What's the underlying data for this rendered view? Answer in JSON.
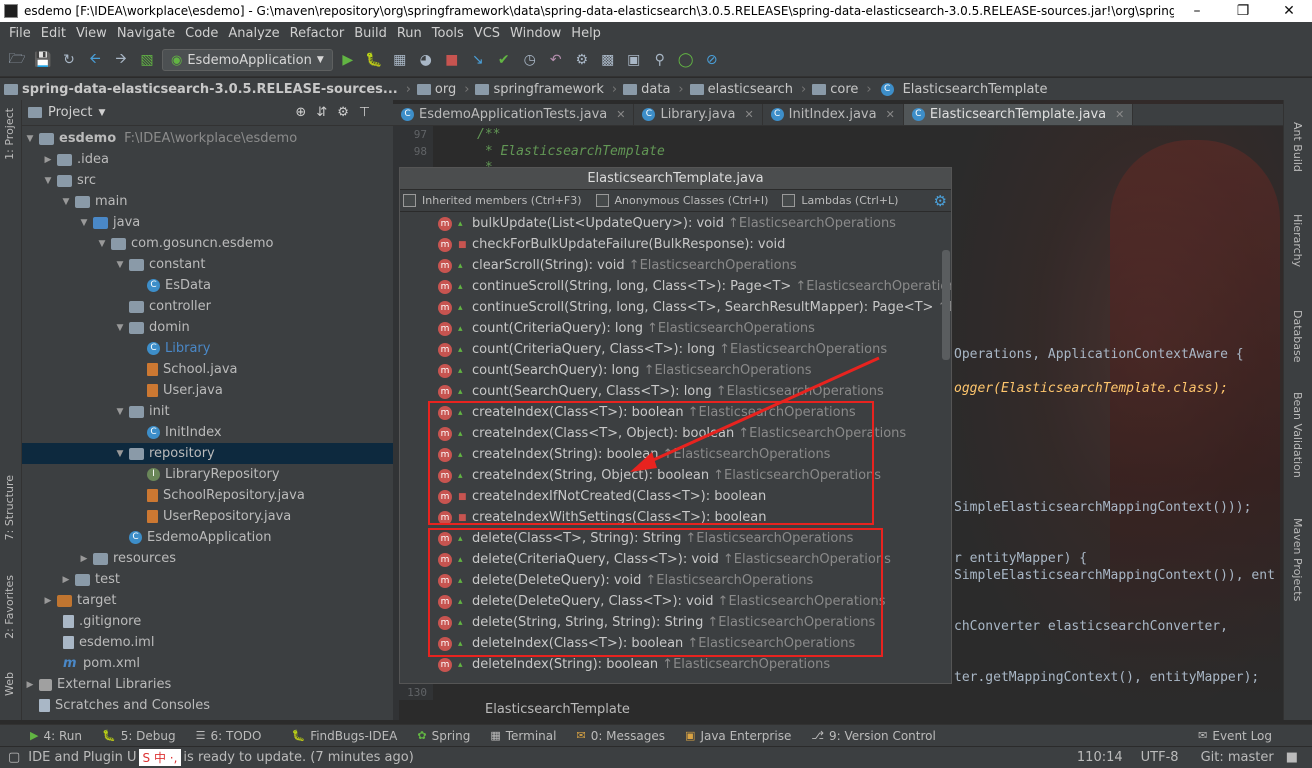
{
  "window": {
    "title": "esdemo [F:\\IDEA\\workplace\\esdemo] - G:\\maven\\repository\\org\\springframework\\data\\spring-data-elasticsearch\\3.0.5.RELEASE\\spring-data-elasticsearch-3.0.5.RELEASE-sources.jar!\\org\\springf..."
  },
  "menu": [
    "File",
    "Edit",
    "View",
    "Navigate",
    "Code",
    "Analyze",
    "Refactor",
    "Build",
    "Run",
    "Tools",
    "VCS",
    "Window",
    "Help"
  ],
  "toolbar": {
    "run_config": "EsdemoApplication"
  },
  "breadcrumb": [
    "spring-data-elasticsearch-3.0.5.RELEASE-sources...",
    "org",
    "springframework",
    "data",
    "elasticsearch",
    "core",
    "ElasticsearchTemplate"
  ],
  "project": {
    "header": "Project",
    "root": "esdemo",
    "root_path": "F:\\IDEA\\workplace\\esdemo",
    "items": [
      ".idea",
      "src",
      "main",
      "java",
      "com.gosuncn.esdemo",
      "constant",
      "EsData",
      "controller",
      "domin",
      "Library",
      "School.java",
      "User.java",
      "init",
      "InitIndex",
      "repository",
      "LibraryRepository",
      "SchoolRepository.java",
      "UserRepository.java",
      "EsdemoApplication",
      "resources",
      "test",
      "target",
      ".gitignore",
      "esdemo.iml",
      "pom.xml",
      "External Libraries",
      "Scratches and Consoles"
    ]
  },
  "tabs": [
    "EsdemoApplicationTests.java",
    "Library.java",
    "InitIndex.java",
    "ElasticsearchTemplate.java"
  ],
  "editor": {
    "line_numbers": [
      "97",
      "98",
      "130"
    ],
    "lines": [
      "/**",
      " * ElasticsearchTemplate",
      " *",
      "Operations, ApplicationContextAware {",
      "ogger(ElasticsearchTemplate.class);",
      "SimpleElasticsearchMappingContext()));",
      "r entityMapper) {",
      "SimpleElasticsearchMappingContext()), ent",
      "chConverter elasticsearchConverter,",
      "ter.getMappingContext(), entityMapper);"
    ]
  },
  "popup": {
    "title": "ElasticsearchTemplate.java",
    "options": [
      "Inherited members (Ctrl+F3)",
      "Anonymous Classes (Ctrl+I)",
      "Lambdas (Ctrl+L)"
    ],
    "members": [
      {
        "sig": "bulkUpdate(List<UpdateQuery>): void",
        "inh": "↑ElasticsearchOperations"
      },
      {
        "sig": "checkForBulkUpdateFailure(BulkResponse): void",
        "inh": ""
      },
      {
        "sig": "clearScroll(String): void",
        "inh": "↑ElasticsearchOperations"
      },
      {
        "sig": "continueScroll(String, long, Class<T>): Page<T>",
        "inh": "↑ElasticsearchOperations"
      },
      {
        "sig": "continueScroll(String, long, Class<T>, SearchResultMapper): Page<T>",
        "inh": "↑Elasticsear"
      },
      {
        "sig": "count(CriteriaQuery): long",
        "inh": "↑ElasticsearchOperations"
      },
      {
        "sig": "count(CriteriaQuery, Class<T>): long",
        "inh": "↑ElasticsearchOperations"
      },
      {
        "sig": "count(SearchQuery): long",
        "inh": "↑ElasticsearchOperations"
      },
      {
        "sig": "count(SearchQuery, Class<T>): long",
        "inh": "↑ElasticsearchOperations"
      },
      {
        "sig": "createIndex(Class<T>): boolean",
        "inh": "↑ElasticsearchOperations"
      },
      {
        "sig": "createIndex(Class<T>, Object): boolean",
        "inh": "↑ElasticsearchOperations"
      },
      {
        "sig": "createIndex(String): boolean",
        "inh": "↑ElasticsearchOperations"
      },
      {
        "sig": "createIndex(String, Object): boolean",
        "inh": "↑ElasticsearchOperations"
      },
      {
        "sig": "createIndexIfNotCreated(Class<T>): boolean",
        "inh": ""
      },
      {
        "sig": "createIndexWithSettings(Class<T>): boolean",
        "inh": ""
      },
      {
        "sig": "delete(Class<T>, String): String",
        "inh": "↑ElasticsearchOperations"
      },
      {
        "sig": "delete(CriteriaQuery, Class<T>): void",
        "inh": "↑ElasticsearchOperations"
      },
      {
        "sig": "delete(DeleteQuery): void",
        "inh": "↑ElasticsearchOperations"
      },
      {
        "sig": "delete(DeleteQuery, Class<T>): void",
        "inh": "↑ElasticsearchOperations"
      },
      {
        "sig": "delete(String, String, String): String",
        "inh": "↑ElasticsearchOperations"
      },
      {
        "sig": "deleteIndex(Class<T>): boolean",
        "inh": "↑ElasticsearchOperations"
      },
      {
        "sig": "deleteIndex(String): boolean",
        "inh": "↑ElasticsearchOperations"
      }
    ],
    "footer": "ElasticsearchTemplate"
  },
  "right_tools": [
    "Ant Build",
    "Hierarchy",
    "Database",
    "Bean Validation",
    "Maven Projects"
  ],
  "left_tools": [
    "1: Project",
    "7: Structure",
    "2: Favorites",
    "Web"
  ],
  "bottom_tools": [
    "4: Run",
    "5: Debug",
    "6: TODO",
    "FindBugs-IDEA",
    "Spring",
    "Terminal",
    "0: Messages",
    "Java Enterprise",
    "9: Version Control",
    "Event Log"
  ],
  "status": {
    "message_left": "IDE and Plugin U",
    "message_right": "is ready to update. (7 minutes ago)",
    "position": "110:14",
    "encoding": "UTF-8",
    "git": "Git: master"
  }
}
